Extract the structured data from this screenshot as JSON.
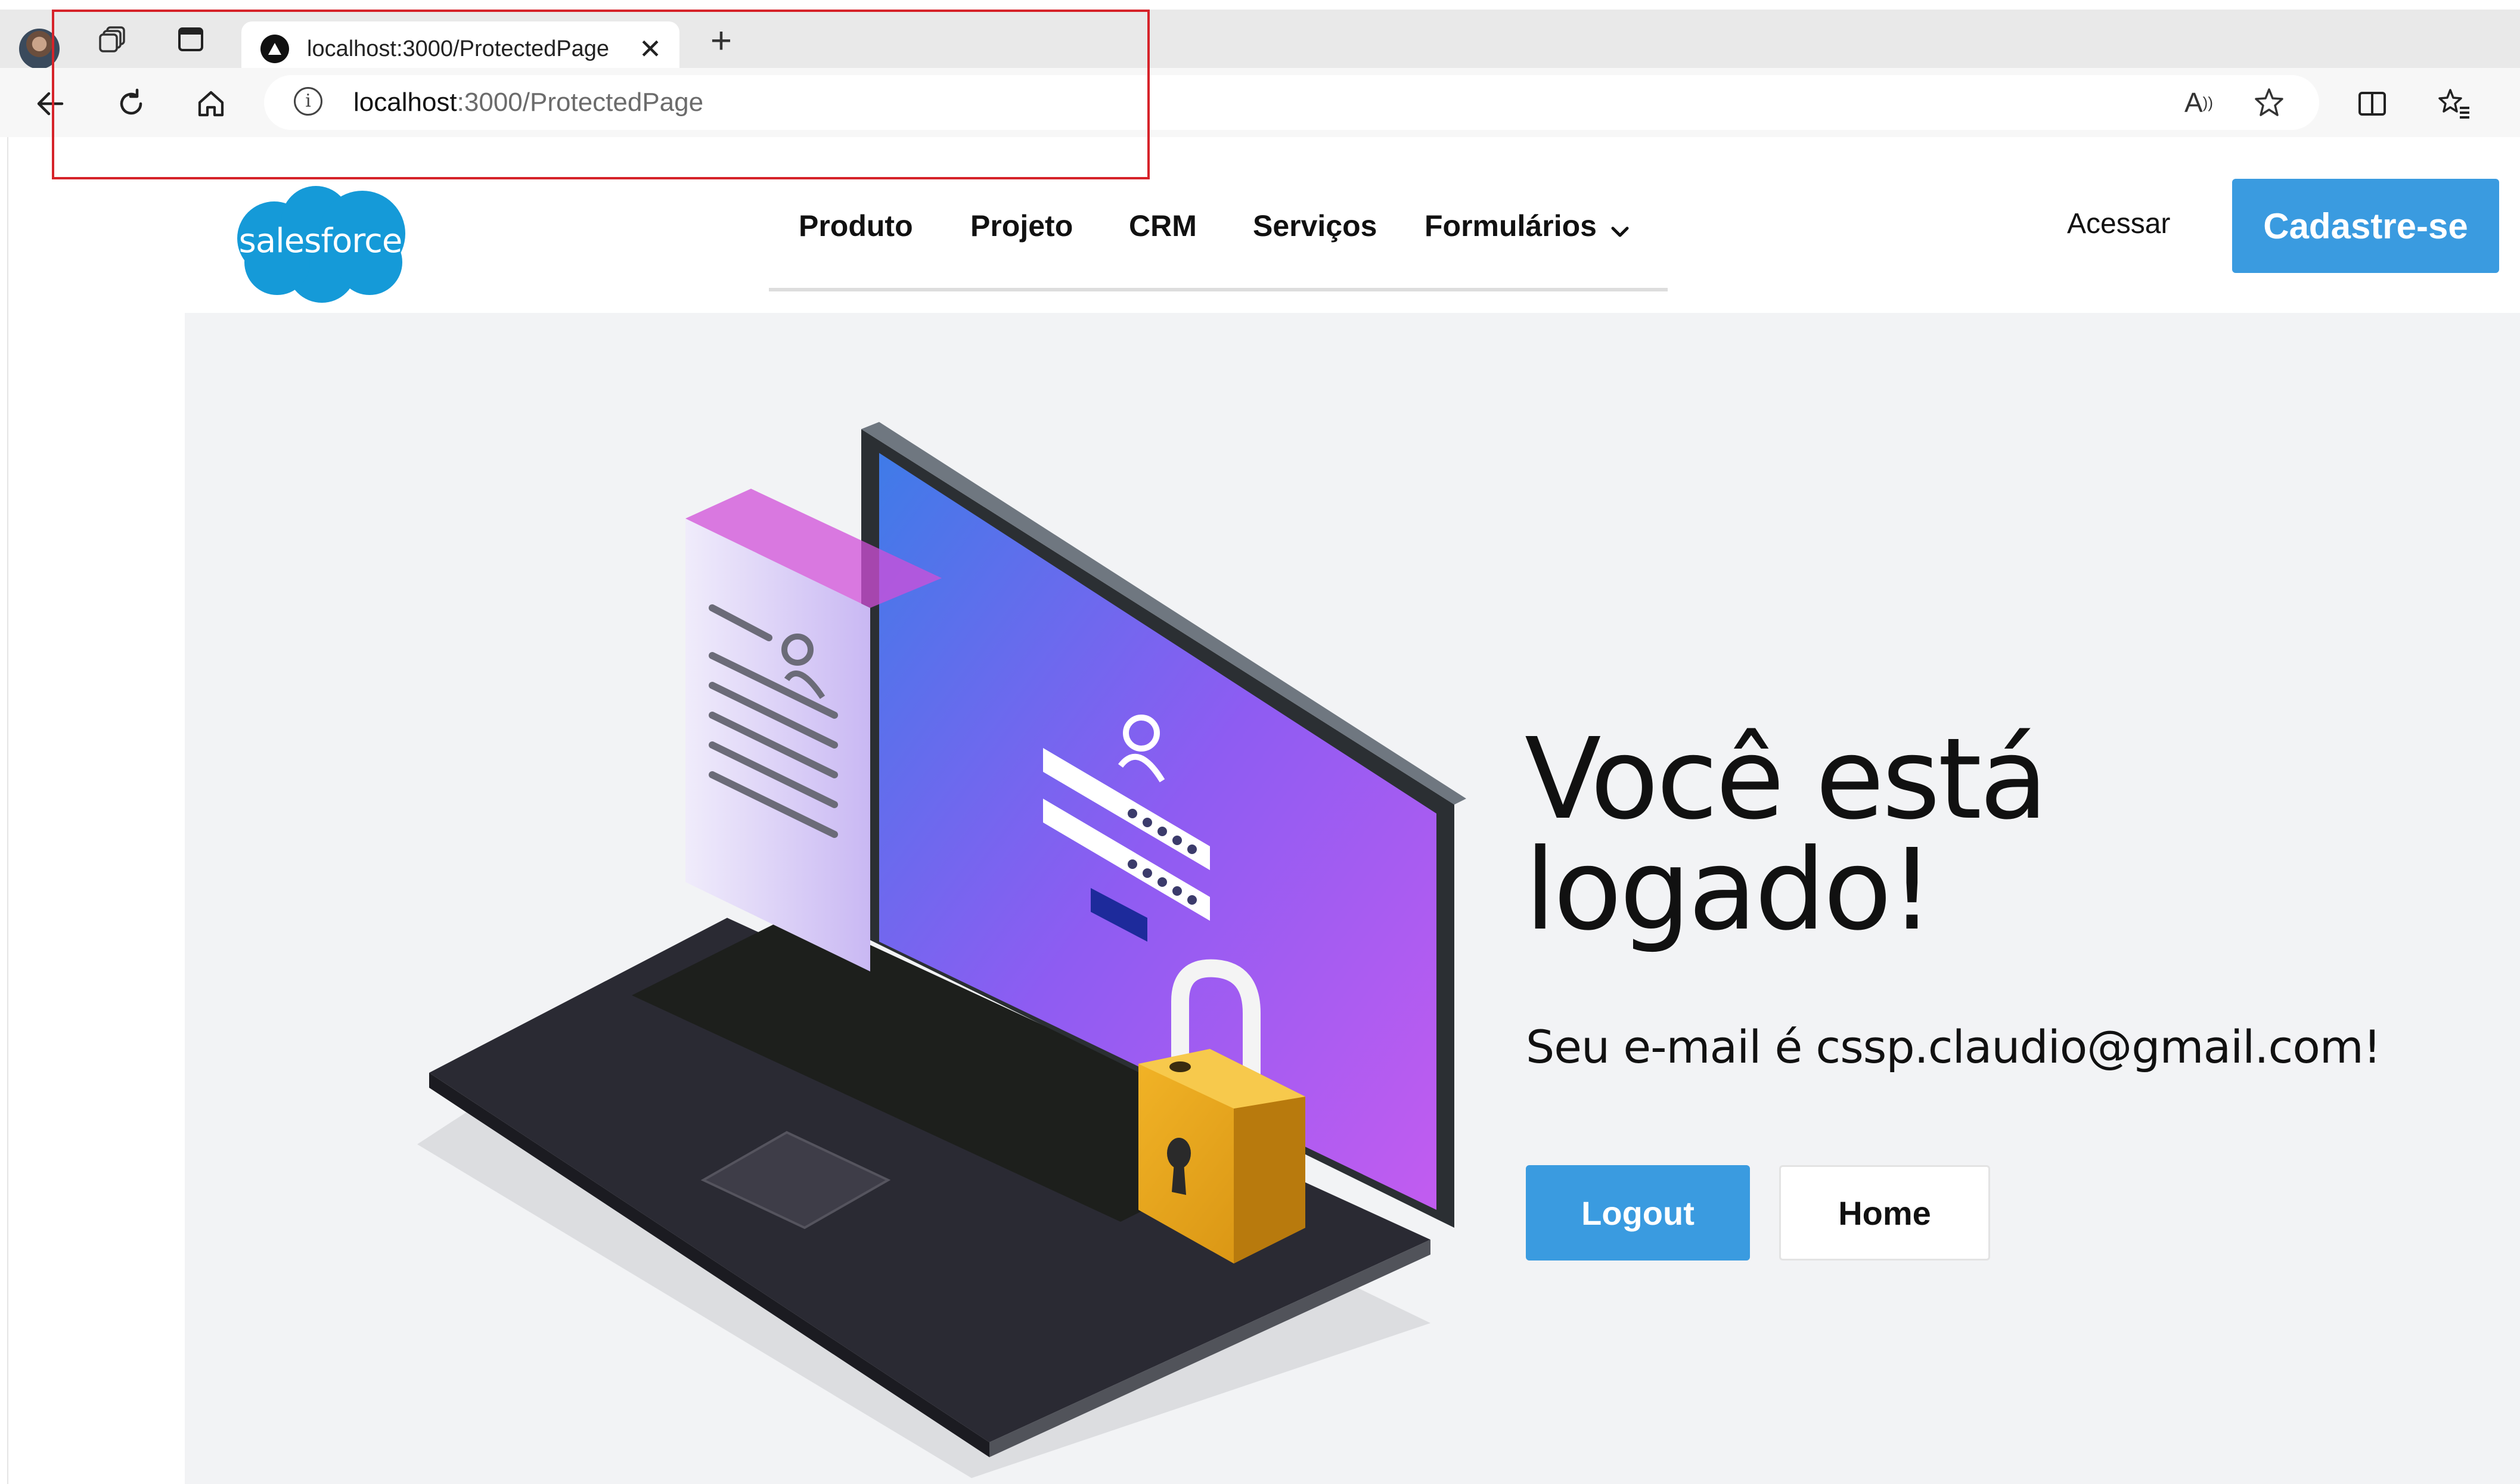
{
  "browser": {
    "tab": {
      "title": "localhost:3000/ProtectedPage",
      "close_glyph": "✕"
    },
    "new_tab_glyph": "+",
    "address": {
      "host": "localhost",
      "path": ":3000/ProtectedPage"
    },
    "icons": [
      "profile-avatar",
      "workspaces-icon",
      "tab-actions-icon",
      "back-icon",
      "refresh-icon",
      "home-icon",
      "site-info-icon",
      "read-aloud-icon",
      "favorite-star-icon",
      "split-screen-icon",
      "favorites-icon"
    ]
  },
  "site": {
    "logo_text": "salesforce",
    "nav": {
      "items": [
        "Produto",
        "Projeto",
        "CRM",
        "Serviços",
        "Formulários"
      ]
    },
    "login_label": "Acessar",
    "signup_label": "Cadastre-se"
  },
  "hero": {
    "title": "Você está logado!",
    "email_text": "Seu e-mail é cssp.claudio@gmail.com!",
    "logout_label": "Logout",
    "home_label": "Home"
  },
  "colors": {
    "accent": "#3a9be0",
    "annotation_box": "#d6232a",
    "hero_background": "#f2f3f5"
  }
}
